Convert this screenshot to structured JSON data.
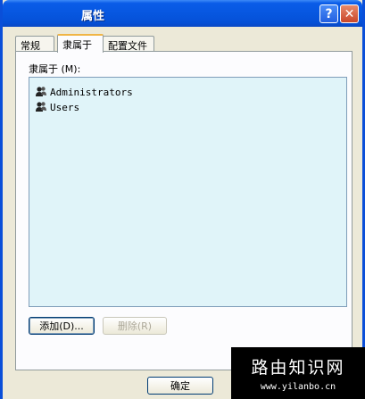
{
  "window": {
    "title": "属性"
  },
  "titlebar_buttons": {
    "help": "?",
    "close": "✕"
  },
  "tabs": [
    {
      "label": "常规"
    },
    {
      "label": "隶属于"
    },
    {
      "label": "配置文件"
    }
  ],
  "member_of": {
    "label": "隶属于 (M):",
    "items": [
      {
        "name": "Administrators",
        "icon": "group-icon"
      },
      {
        "name": "Users",
        "icon": "group-icon"
      }
    ]
  },
  "buttons": {
    "add": "添加(D)...",
    "remove": "删除(R)",
    "ok": "确定"
  },
  "watermark": {
    "title": "路由知识网",
    "url": "www.yilanbo.cn"
  }
}
